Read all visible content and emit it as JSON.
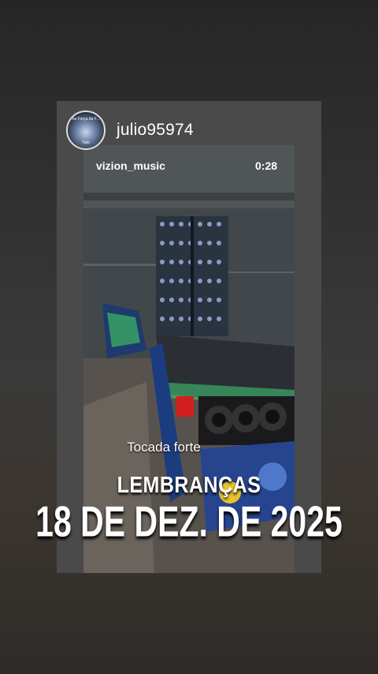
{
  "story": {
    "username": "julio95974",
    "avatar_text": [
      "na Força da F...",
      "Tato"
    ],
    "music_label": "vizion_music",
    "duration": "0:28",
    "caption": "Tocada forte"
  },
  "memory": {
    "label": "LEMBRANÇAS",
    "date": "18 DE DEZ. DE 2025"
  },
  "icons": {
    "avatar": "profile-photo"
  }
}
